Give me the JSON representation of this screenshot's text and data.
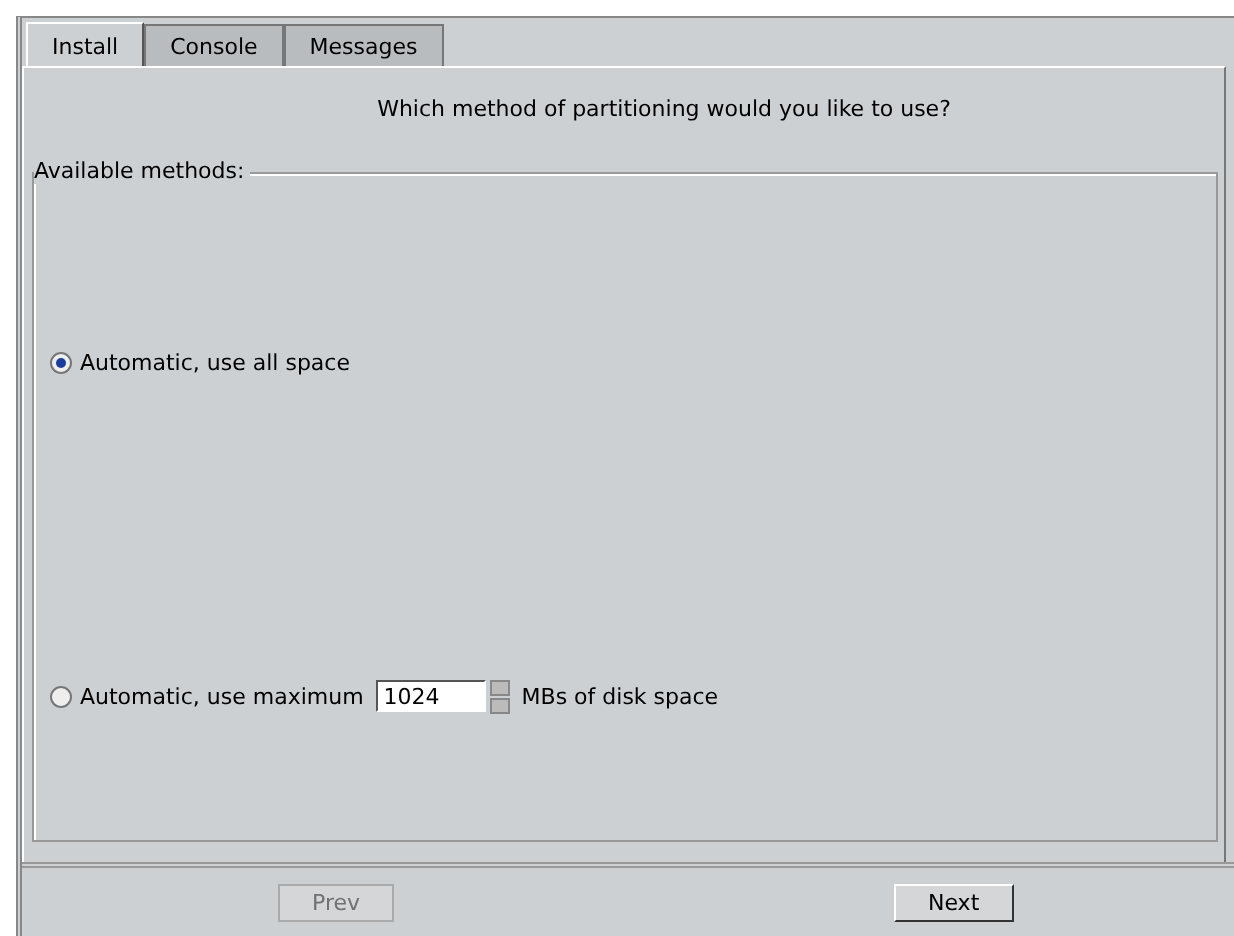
{
  "tabs": [
    {
      "label": "Install",
      "selected": true
    },
    {
      "label": "Console",
      "selected": false
    },
    {
      "label": "Messages",
      "selected": false
    }
  ],
  "question": "Which method of partitioning would you like to use?",
  "group": {
    "title": "Available methods:",
    "options": [
      {
        "kind": "plain",
        "label": "Automatic, use all space",
        "selected": true
      },
      {
        "kind": "spin",
        "label": "Automatic, use maximum",
        "value": "1024",
        "suffix": "MBs of disk space",
        "selected": false
      }
    ]
  },
  "buttons": [
    {
      "label": "Prev",
      "disabled": true
    },
    {
      "label": "Next",
      "disabled": false
    }
  ]
}
